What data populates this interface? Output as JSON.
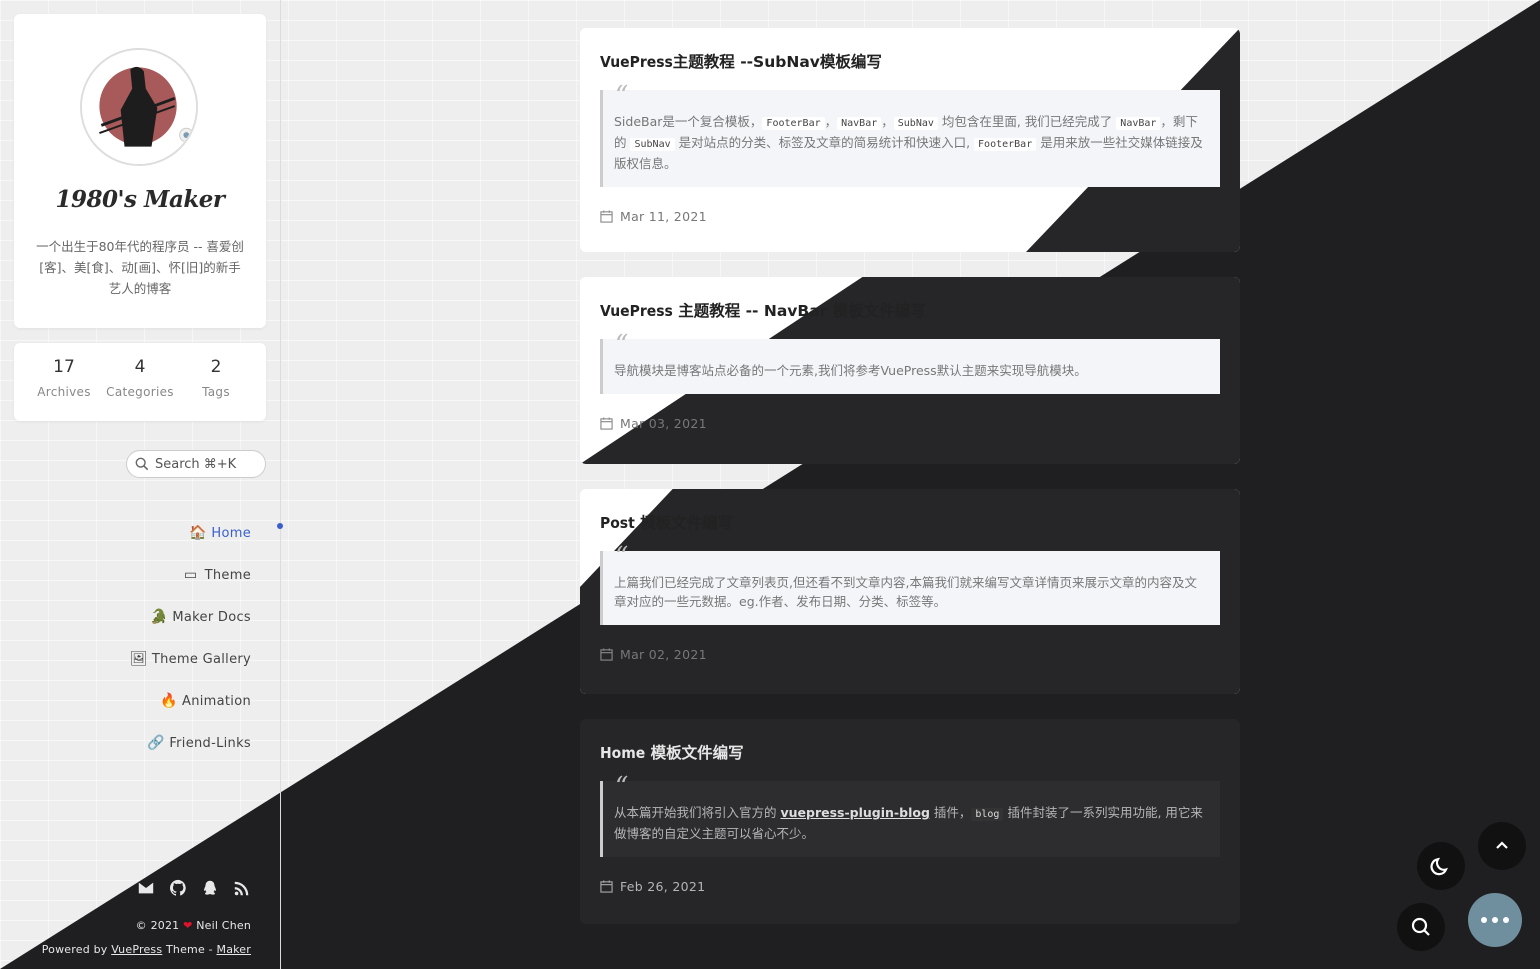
{
  "profile": {
    "name": "1980's Maker",
    "bio": "一个出生于80年代的程序员 -- 喜爱创[客]、美[食]、动[画]、怀[旧]的新手艺人的博客"
  },
  "stats": [
    {
      "value": "17",
      "label": "Archives"
    },
    {
      "value": "4",
      "label": "Categories"
    },
    {
      "value": "2",
      "label": "Tags"
    }
  ],
  "search": {
    "placeholder": "Search ⌘+K"
  },
  "nav": [
    {
      "label": "Home",
      "icon": "🏠",
      "icon_name": "home-icon",
      "active": true
    },
    {
      "label": "Theme",
      "icon": "▭",
      "icon_name": "theme-icon",
      "active": false
    },
    {
      "label": "Maker Docs",
      "icon": "🐊",
      "icon_name": "docs-icon",
      "active": false
    },
    {
      "label": "Theme Gallery",
      "icon": "🖼",
      "icon_name": "gallery-icon",
      "active": false
    },
    {
      "label": "Animation",
      "icon": "🔥",
      "icon_name": "fire-icon",
      "active": false
    },
    {
      "label": "Friend-Links",
      "icon": "🔗",
      "icon_name": "link-icon",
      "active": false
    }
  ],
  "footer": {
    "year": "© 2021",
    "heart": "❤",
    "author": "Neil Chen",
    "powered_prefix": "Powered by",
    "vuepress": "VuePress",
    "theme_text": "Theme -",
    "maker": "Maker"
  },
  "posts": [
    {
      "title_bold": "VuePress",
      "title_rest": "主题教程 --SubNav模板编写",
      "excerpt_parts": {
        "p1": "SideBar是一个复合模板，",
        "c1": "FooterBar",
        "p2": "，",
        "c2": "NavBar",
        "p3": "，",
        "c3": "SubNav",
        "p4": " 均包含在里面, 我们已经完成了 ",
        "c4": "NavBar",
        "p5": "，剩下的 ",
        "c5": "SubNav",
        "p6": " 是对站点的分类、标签及文章的简易统计和快速入口, ",
        "c6": "FooterBar",
        "p7": " 是用来放一些社交媒体链接及版权信息。"
      },
      "date": "Mar 11, 2021"
    },
    {
      "title_bold": "VuePress",
      "title_rest": " 主题教程 -- NavBar 模板文件编写",
      "excerpt": "导航模块是博客站点必备的一个元素,我们将参考VuePress默认主题来实现导航模块。",
      "date": "Mar 03, 2021"
    },
    {
      "title_bold": "Post",
      "title_rest": " 模板文件编写",
      "excerpt": "上篇我们已经完成了文章列表页,但还看不到文章内容,本篇我们就来编写文章详情页来展示文章的内容及文章对应的一些元数据。eg.作者、发布日期、分类、标签等。",
      "date": "Mar 02, 2021"
    },
    {
      "title_bold": "Home",
      "title_rest": " 模板文件编写",
      "excerpt_parts": {
        "p1": "从本篇开始我们将引入官方的 ",
        "link": "vuepress-plugin-blog",
        "p2": " 插件，",
        "c1": "blog",
        "p3": " 插件封装了一系列实用功能, 用它来做博客的自定义主题可以省心不少。"
      },
      "date": "Feb 26, 2021"
    }
  ],
  "colors": {
    "accent": "#3a5fcd",
    "dark_bg": "#1f1f21",
    "light_bg": "#eeeeee",
    "fab_more": "#6f8f9e"
  }
}
